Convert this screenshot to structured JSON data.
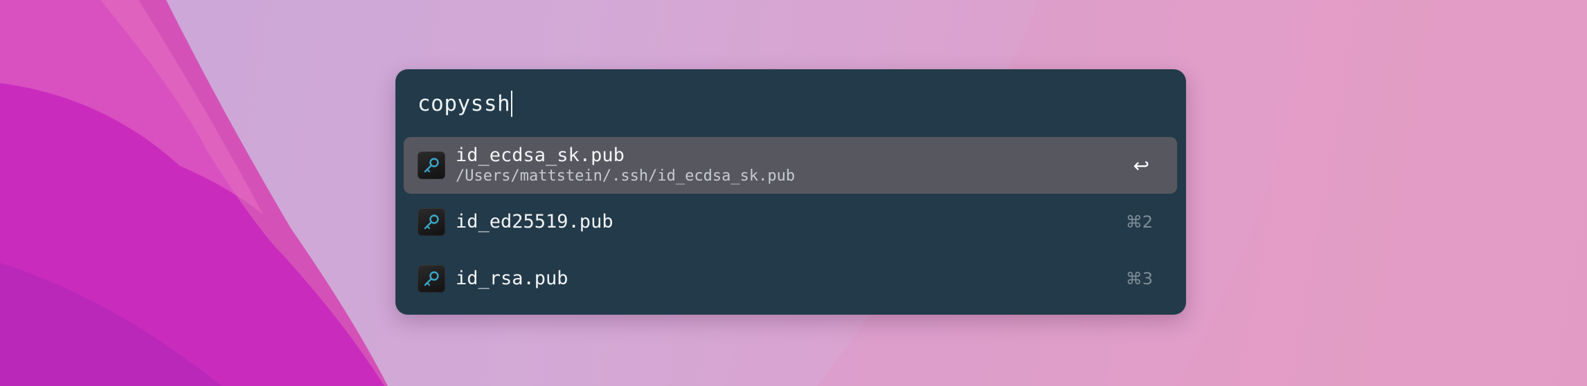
{
  "search": {
    "query": "copyssh"
  },
  "results": [
    {
      "title": "id_ecdsa_sk.pub",
      "subtitle": "/Users/mattstein/.ssh/id_ecdsa_sk.pub",
      "shortcut": "↩",
      "icon": "key-icon",
      "selected": true
    },
    {
      "title": "id_ed25519.pub",
      "subtitle": "",
      "shortcut": "⌘2",
      "icon": "key-icon",
      "selected": false
    },
    {
      "title": "id_rsa.pub",
      "subtitle": "",
      "shortcut": "⌘3",
      "icon": "key-icon",
      "selected": false
    }
  ],
  "colors": {
    "panel": "#223a49",
    "selected_row": "#57585f",
    "key_icon": "#3aa6c8"
  }
}
